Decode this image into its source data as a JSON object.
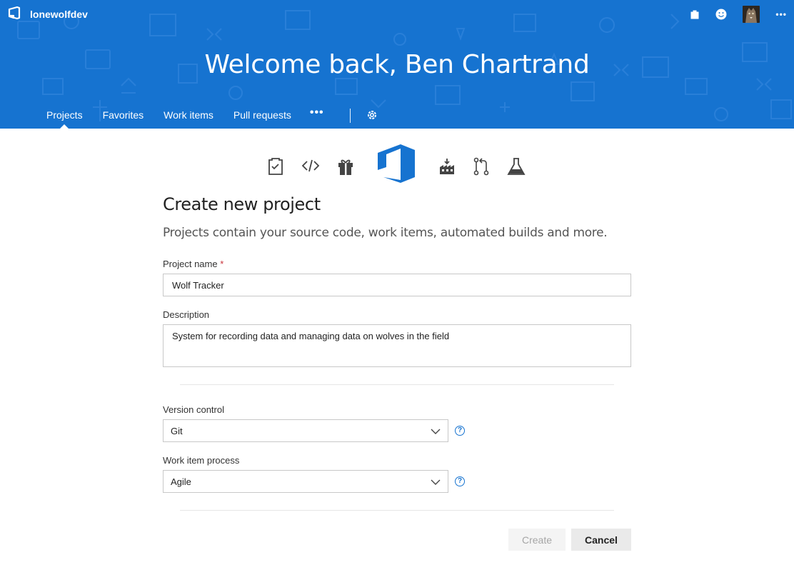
{
  "header": {
    "org_name": "lonewolfdev",
    "welcome": "Welcome back, Ben Chartrand",
    "nav": {
      "projects": "Projects",
      "favorites": "Favorites",
      "work_items": "Work items",
      "pull_requests": "Pull requests",
      "more": "•••"
    },
    "top_more": "•••"
  },
  "icons": [
    "work-items-icon",
    "code-icon",
    "release-gift-icon",
    "vsts-logo-icon",
    "build-icon",
    "pull-request-icon",
    "test-flask-icon"
  ],
  "colors": {
    "header": "#1673d0",
    "accent": "#1673d0",
    "required": "#c8343c"
  },
  "form": {
    "title": "Create new project",
    "subtitle": "Projects contain your source code, work items, automated builds and more.",
    "project_name_label": "Project name",
    "required_mark": "*",
    "project_name_value": "Wolf Tracker",
    "description_label": "Description",
    "description_value": "System for recording data and managing data on wolves in the field",
    "version_control_label": "Version control",
    "version_control_value": "Git",
    "work_item_process_label": "Work item process",
    "work_item_process_value": "Agile",
    "help_glyph": "?",
    "create_label": "Create",
    "cancel_label": "Cancel"
  }
}
